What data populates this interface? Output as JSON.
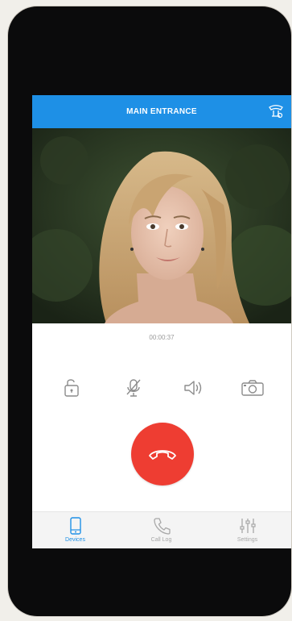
{
  "header": {
    "title": "MAIN ENTRANCE",
    "icon": "intercom-handset-icon"
  },
  "call": {
    "timer": "00:00:37"
  },
  "controls": [
    {
      "name": "unlock-icon",
      "label": ""
    },
    {
      "name": "mic-muted-icon",
      "label": ""
    },
    {
      "name": "speaker-icon",
      "label": ""
    },
    {
      "name": "camera-icon",
      "label": ""
    }
  ],
  "tabs": [
    {
      "label": "Devices",
      "icon": "phone-device-icon",
      "active": true
    },
    {
      "label": "Call Log",
      "icon": "handset-icon",
      "active": false
    },
    {
      "label": "Settings",
      "icon": "sliders-icon",
      "active": false
    }
  ],
  "colors": {
    "accent": "#1e90e6",
    "hangup": "#ee3d32",
    "tab_inactive": "#a8a8a8"
  }
}
